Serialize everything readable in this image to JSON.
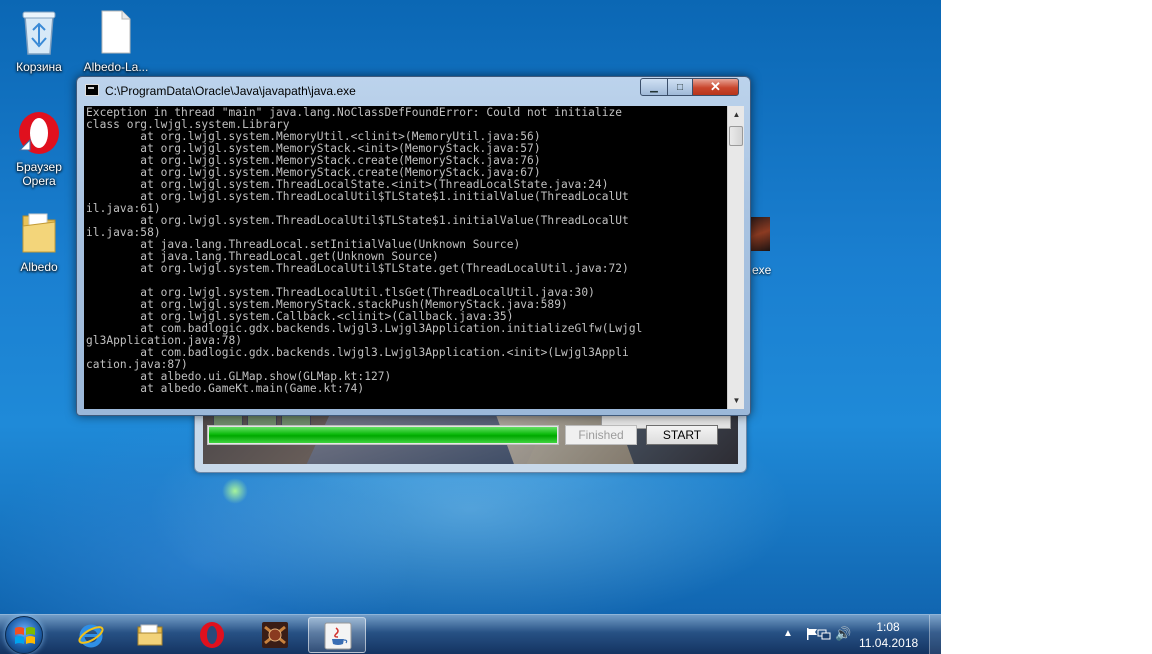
{
  "desktop": {
    "icons": [
      {
        "name": "recycle-bin",
        "label": "Корзина"
      },
      {
        "name": "albedo-launcher-file",
        "label": "Albedo-La..."
      },
      {
        "name": "opera-browser",
        "label": "Браузер\nOpera"
      },
      {
        "name": "albedo-folder",
        "label": "Albedo"
      },
      {
        "name": "albedo-exe",
        "label": "exe"
      }
    ]
  },
  "launcher": {
    "progress": 1.0,
    "status_label": "Finished",
    "start_label": "START",
    "progress_color": "#0cba0c"
  },
  "console": {
    "title": "C:\\ProgramData\\Oracle\\Java\\javapath\\java.exe",
    "min_glyph": "▁",
    "max_glyph": "□",
    "close_glyph": "✕",
    "output": "Exception in thread \"main\" java.lang.NoClassDefFoundError: Could not initialize\nclass org.lwjgl.system.Library\n        at org.lwjgl.system.MemoryUtil.<clinit>(MemoryUtil.java:56)\n        at org.lwjgl.system.MemoryStack.<init>(MemoryStack.java:57)\n        at org.lwjgl.system.MemoryStack.create(MemoryStack.java:76)\n        at org.lwjgl.system.MemoryStack.create(MemoryStack.java:67)\n        at org.lwjgl.system.ThreadLocalState.<init>(ThreadLocalState.java:24)\n        at org.lwjgl.system.ThreadLocalUtil$TLState$1.initialValue(ThreadLocalUt\nil.java:61)\n        at org.lwjgl.system.ThreadLocalUtil$TLState$1.initialValue(ThreadLocalUt\nil.java:58)\n        at java.lang.ThreadLocal.setInitialValue(Unknown Source)\n        at java.lang.ThreadLocal.get(Unknown Source)\n        at org.lwjgl.system.ThreadLocalUtil$TLState.get(ThreadLocalUtil.java:72)\n\n        at org.lwjgl.system.ThreadLocalUtil.tlsGet(ThreadLocalUtil.java:30)\n        at org.lwjgl.system.MemoryStack.stackPush(MemoryStack.java:589)\n        at org.lwjgl.system.Callback.<clinit>(Callback.java:35)\n        at com.badlogic.gdx.backends.lwjgl3.Lwjgl3Application.initializeGlfw(Lwjgl\ngl3Application.java:78)\n        at com.badlogic.gdx.backends.lwjgl3.Lwjgl3Application.<init>(Lwjgl3Appli\ncation.java:87)\n        at albedo.ui.GLMap.show(GLMap.kt:127)\n        at albedo.GameKt.main(Game.kt:74)",
    "scroll_up": "▲",
    "scroll_down": "▼"
  },
  "taskbar": {
    "buttons": [
      {
        "name": "internet-explorer"
      },
      {
        "name": "file-explorer"
      },
      {
        "name": "opera"
      },
      {
        "name": "albedo-game"
      },
      {
        "name": "java-console",
        "active": true
      }
    ],
    "tray": {
      "expand_glyph": "▲",
      "volume_glyph": "🔊",
      "time": "1:08",
      "date": "11.04.2018"
    }
  }
}
